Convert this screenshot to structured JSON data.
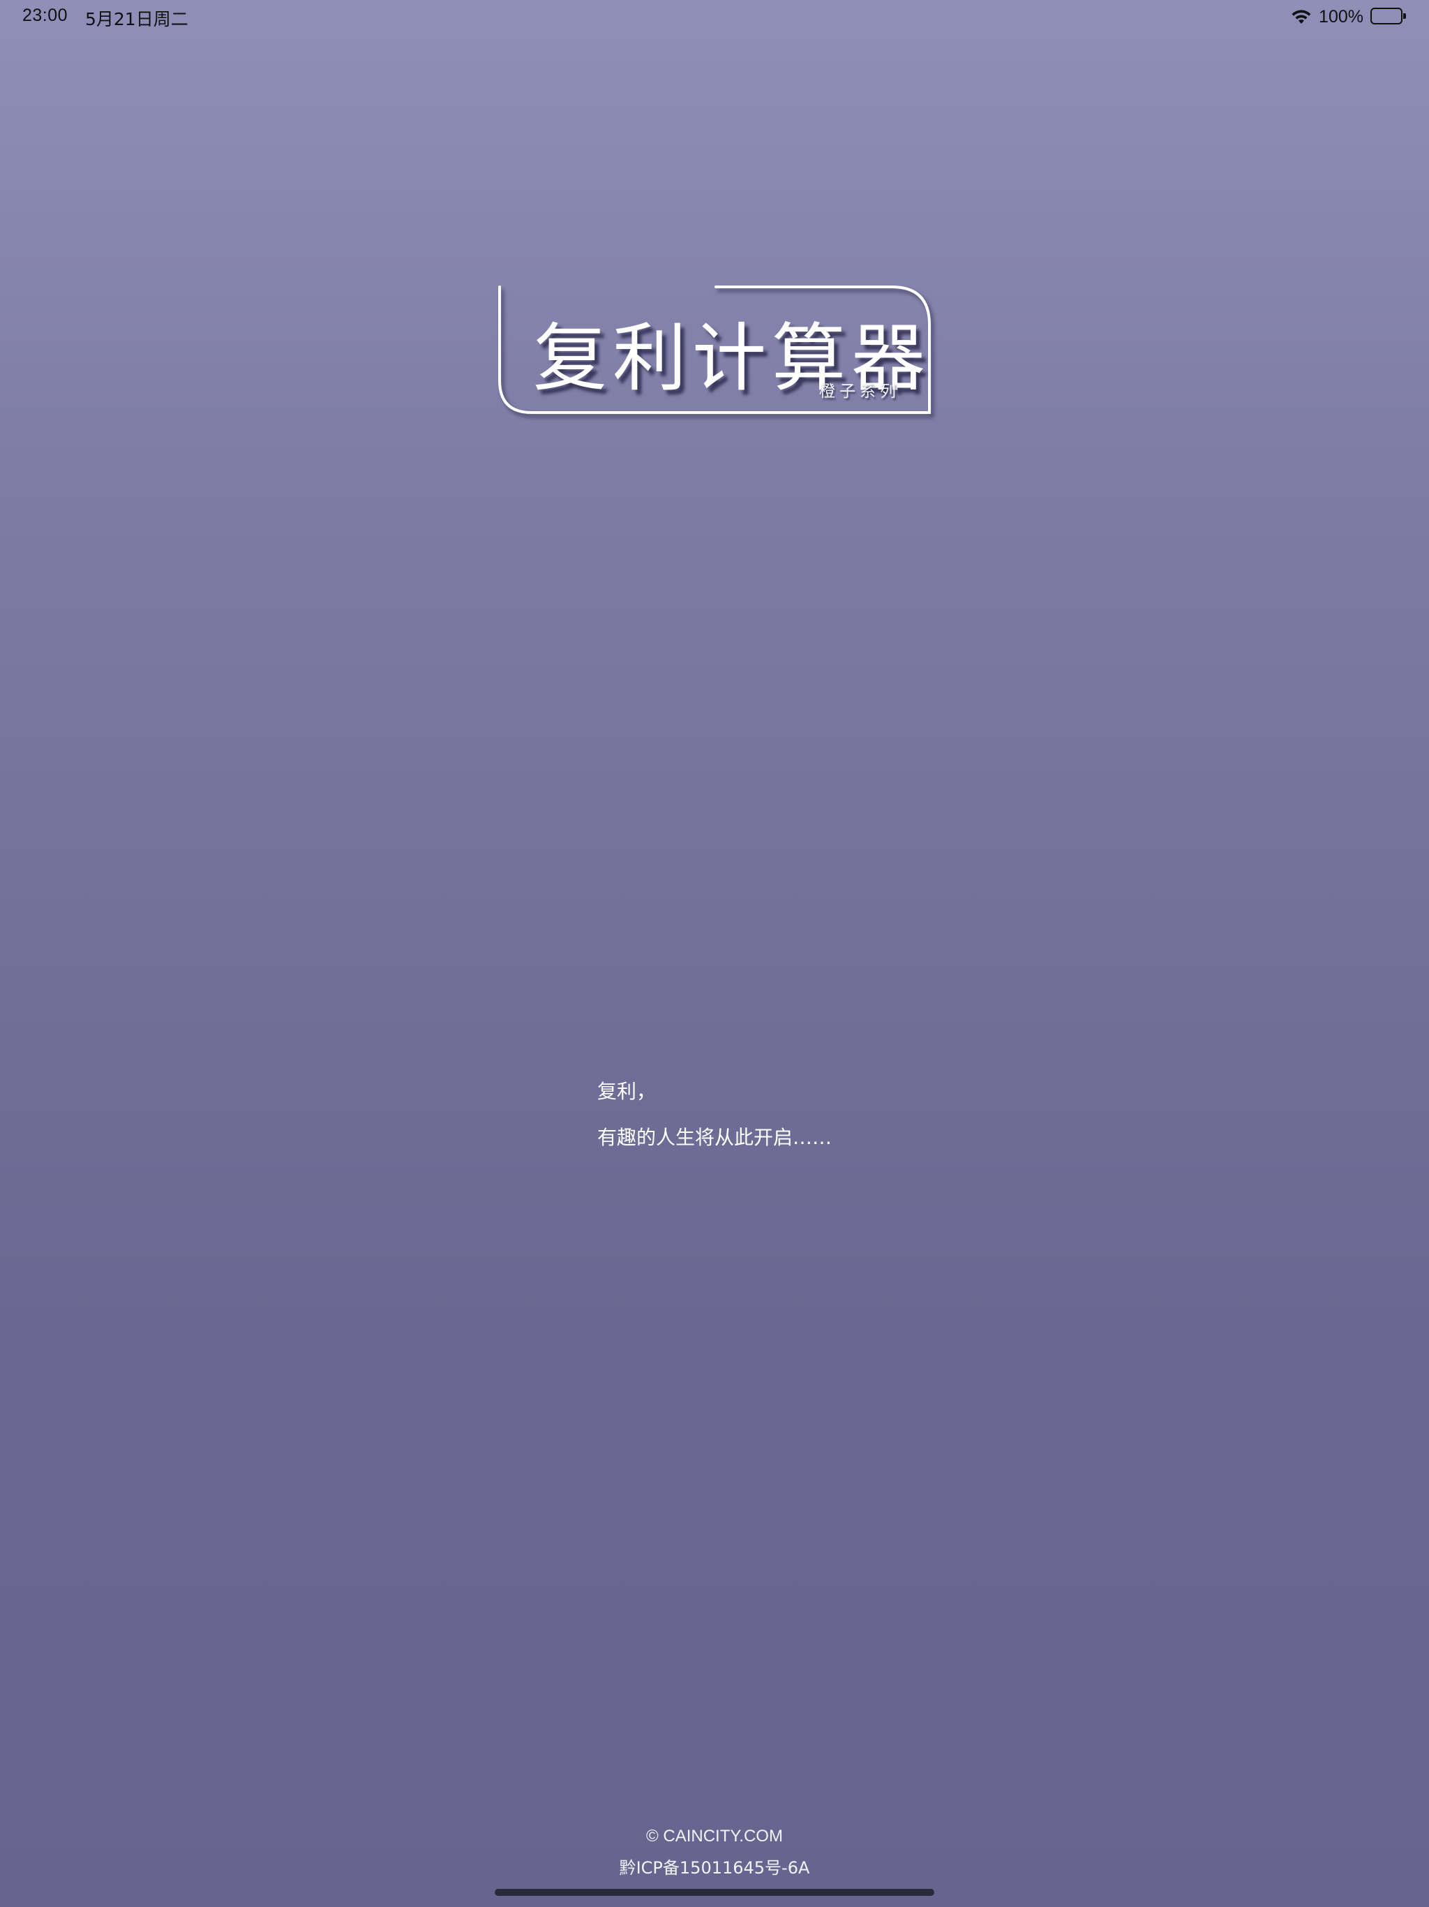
{
  "status_bar": {
    "time": "23:00",
    "date": "5月21日周二",
    "battery_percent": "100%",
    "battery_level": 1.0,
    "icons": [
      "wifi-icon",
      "battery-icon"
    ]
  },
  "logo": {
    "title": "复利计算器",
    "subtitle": "橙子系列"
  },
  "slogan": {
    "line1": "复利，",
    "line2": "有趣的人生将从此开启……"
  },
  "footer": {
    "copyright": "© CAINCITY.COM",
    "icp": "黔ICP备15011645号-6A"
  },
  "colors": {
    "background_top": "#8f8fb7",
    "background_bottom": "#676590",
    "text": "#ffffff",
    "status_text": "#111111"
  }
}
